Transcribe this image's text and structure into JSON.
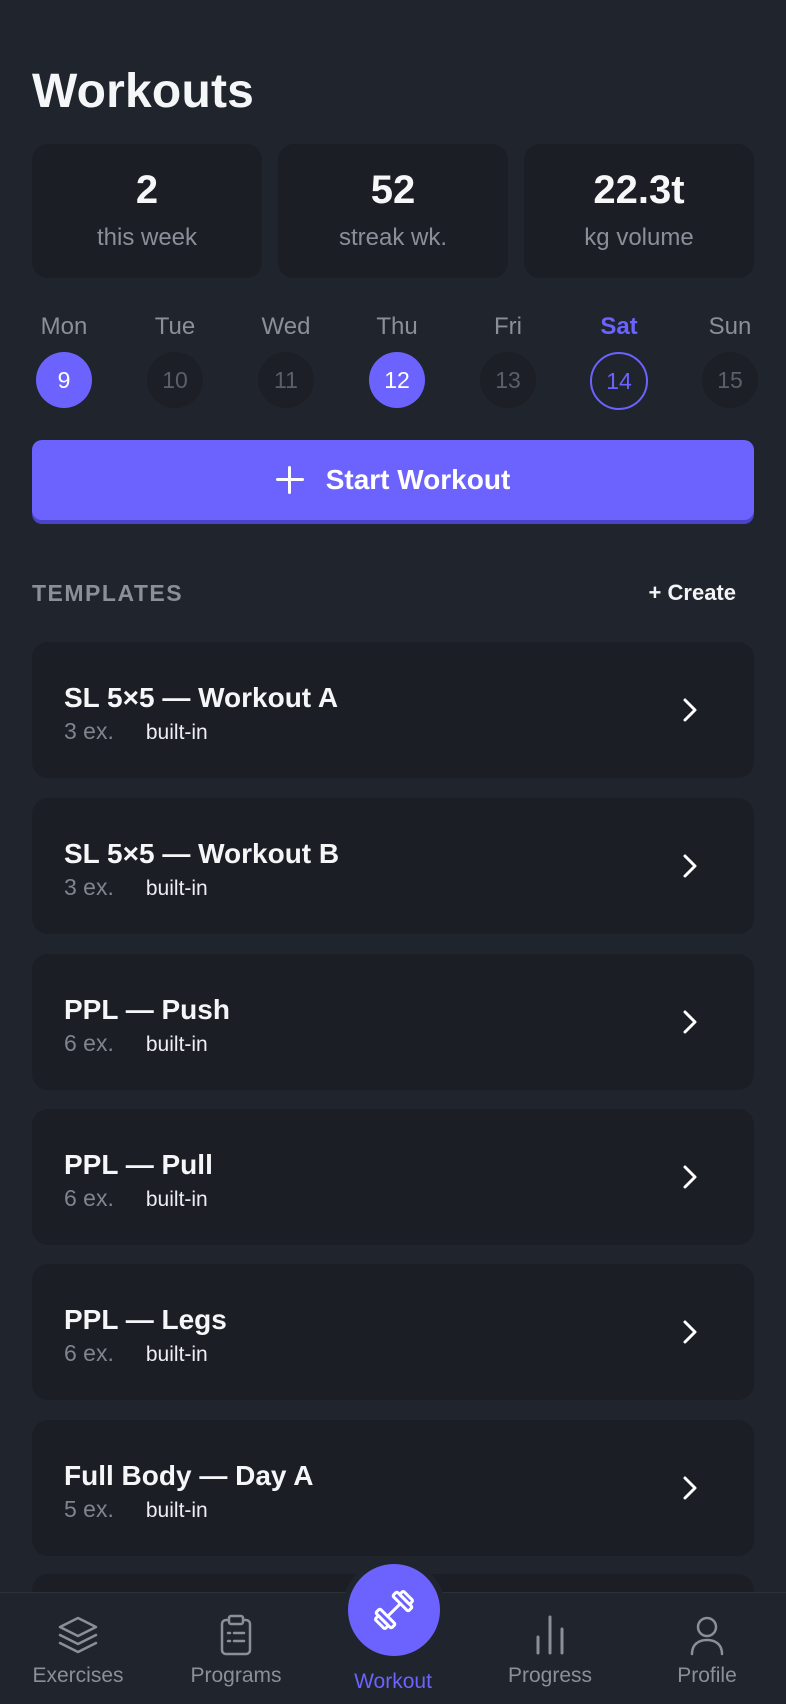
{
  "header": {
    "title": "Workouts"
  },
  "stats": [
    {
      "value": "2",
      "label": "this week"
    },
    {
      "value": "52",
      "label": "streak wk."
    },
    {
      "value": "22.3t",
      "label": "kg volume"
    }
  ],
  "week": [
    {
      "name": "Mon",
      "date": "9",
      "state": "done"
    },
    {
      "name": "Tue",
      "date": "10",
      "state": "none"
    },
    {
      "name": "Wed",
      "date": "11",
      "state": "none"
    },
    {
      "name": "Thu",
      "date": "12",
      "state": "done"
    },
    {
      "name": "Fri",
      "date": "13",
      "state": "none"
    },
    {
      "name": "Sat",
      "date": "14",
      "state": "today"
    },
    {
      "name": "Sun",
      "date": "15",
      "state": "none"
    }
  ],
  "start_button": {
    "label": "Start Workout",
    "icon": "plus-icon"
  },
  "templates_section": {
    "title": "TEMPLATES",
    "create_label": "+ Create"
  },
  "templates": [
    {
      "name": "SL 5×5 — Workout A",
      "count": "3 ex.",
      "tag": "built-in"
    },
    {
      "name": "SL 5×5 — Workout B",
      "count": "3 ex.",
      "tag": "built-in"
    },
    {
      "name": "PPL — Push",
      "count": "6 ex.",
      "tag": "built-in"
    },
    {
      "name": "PPL — Pull",
      "count": "6 ex.",
      "tag": "built-in"
    },
    {
      "name": "PPL — Legs",
      "count": "6 ex.",
      "tag": "built-in"
    },
    {
      "name": "Full Body — Day A",
      "count": "5 ex.",
      "tag": "built-in"
    }
  ],
  "tabbar": {
    "exercises": {
      "label": "Exercises",
      "icon": "layers-icon"
    },
    "programs": {
      "label": "Programs",
      "icon": "clipboard-icon"
    },
    "workout": {
      "label": "Workout",
      "icon": "dumbbell-icon",
      "active": true
    },
    "progress": {
      "label": "Progress",
      "icon": "bar-chart-icon"
    },
    "profile": {
      "label": "Profile",
      "icon": "person-icon"
    }
  },
  "colors": {
    "accent": "#6c63ff",
    "background": "#20242c",
    "card": "#1b1e24",
    "muted_text": "#8a8f99"
  }
}
